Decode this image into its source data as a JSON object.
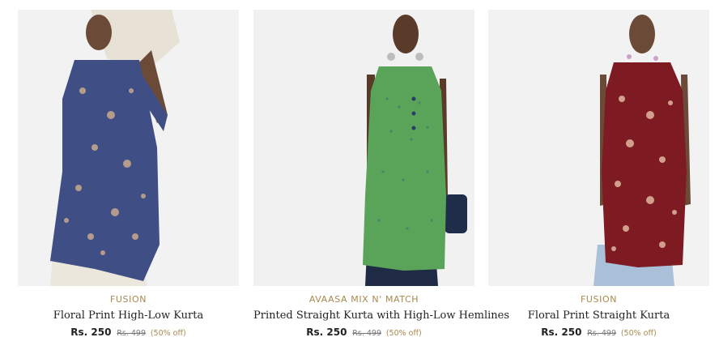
{
  "products": [
    {
      "brand": "FUSION",
      "title": "Floral Print High-Low Kurta",
      "price": "Rs. 250",
      "mrp": "Rs. 499",
      "discount": "(50% off)",
      "colors": {
        "kurta": "#3f4f86",
        "pattern": "#c9a98c",
        "background": "#f2f2f2"
      }
    },
    {
      "brand": "AVAASA MIX N' MATCH",
      "title": "Printed Straight Kurta with High-Low Hemlines",
      "price": "Rs. 250",
      "mrp": "Rs. 499",
      "discount": "(50% off)",
      "colors": {
        "kurta": "#5aa45a",
        "pattern": "#2f6f7a",
        "background": "#f1f1f1"
      }
    },
    {
      "brand": "FUSION",
      "title": "Floral Print Straight Kurta",
      "price": "Rs. 250",
      "mrp": "Rs. 499",
      "discount": "(50% off)",
      "colors": {
        "kurta": "#7d1a22",
        "pattern": "#e2b7a0",
        "background": "#f2f2f2"
      }
    }
  ]
}
